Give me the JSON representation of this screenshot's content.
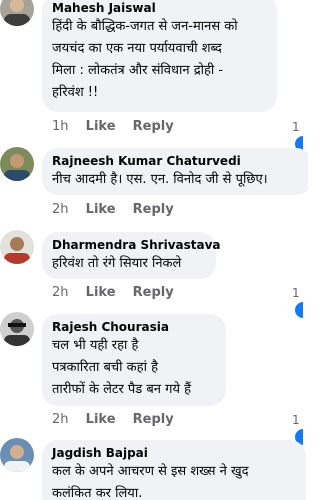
{
  "comments": [
    {
      "author": "Mahesh Jaiswal",
      "lines": [
        "हिंदी के बौद्धिक-जगत से जन-मानस को",
        "जयचंद का एक नया पर्यायवाची शब्द",
        "मिला : लोकतंत्र और संविधान द्रोही -",
        "हरिवंश !!"
      ],
      "time": "1h",
      "like": "Like",
      "reply": "Reply",
      "reactions": "1"
    },
    {
      "author": "Rajneesh Kumar Chaturvedi",
      "lines": [
        "नीच आदमी है। एस. एन. विनोद जी से पूछिए।"
      ],
      "time": "2h",
      "like": "Like",
      "reply": "Reply"
    },
    {
      "author": "Dharmendra Shrivastava",
      "lines": [
        "हरिवंश तो रंगे सियार निकले"
      ],
      "time": "2h",
      "like": "Like",
      "reply": "Reply",
      "reactions": "1"
    },
    {
      "author": "Rajesh Chourasia",
      "lines": [
        "चल भी यही रहा है",
        "पत्रकारिता बची कहां है",
        "तारीफों के लेटर पैड बन गये हैं"
      ],
      "time": "2h",
      "like": "Like",
      "reply": "Reply",
      "reactions": "1"
    },
    {
      "author": "Jagdish Bajpai",
      "lines": [
        "कल के अपने आचरण से इस शख्स ने खुद",
        "कलंकित कर लिया."
      ]
    }
  ]
}
